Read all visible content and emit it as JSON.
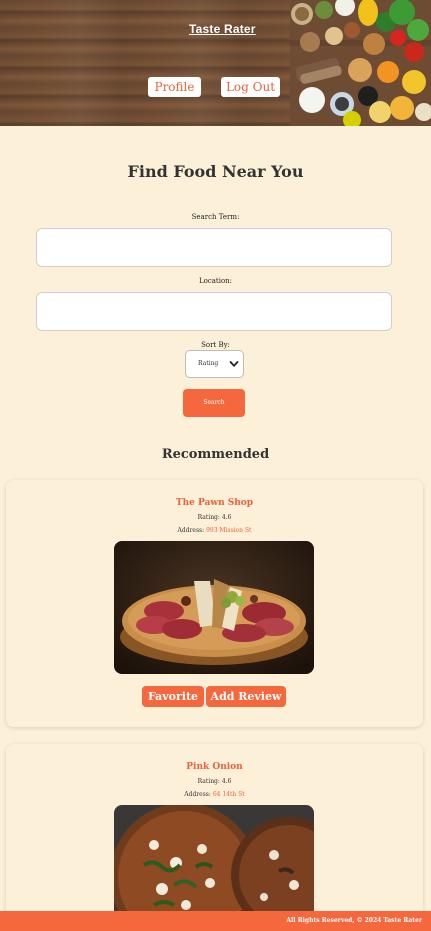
{
  "header": {
    "brand": "Taste Rater",
    "profile_label": "Profile",
    "logout_label": "Log Out"
  },
  "search": {
    "title": "Find Food Near You",
    "term_label": "Search Term:",
    "term_value": "",
    "location_label": "Location:",
    "location_value": "",
    "sort_label": "Sort By:",
    "sort_value": "Rating",
    "search_label": "Search"
  },
  "recommended": {
    "title": "Recommended",
    "items": [
      {
        "name": "The Pawn Shop",
        "rating_text": "Rating: 4.6",
        "address_prefix": "Address: ",
        "address": "993 Mission St",
        "favorite_label": "Favorite",
        "review_label": "Add Review"
      },
      {
        "name": "Pink Onion",
        "rating_text": "Rating: 4.6",
        "address_prefix": "Address: ",
        "address": "64 14th St"
      }
    ]
  },
  "footer": {
    "text": "All Rights Reserved, © 2024 Taste Rater"
  },
  "colors": {
    "accent": "#f5673d",
    "background": "#fdf0d8"
  }
}
